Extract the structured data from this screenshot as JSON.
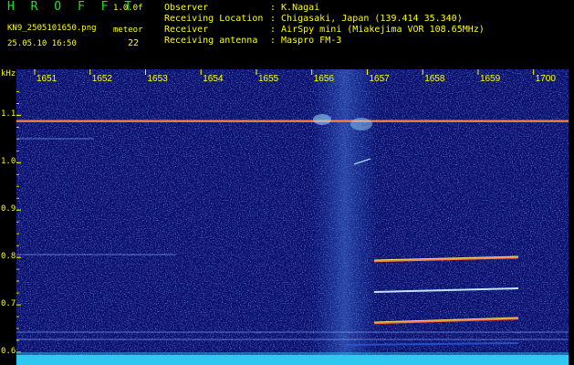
{
  "header": {
    "title": "H R O F F T",
    "version": "1.0.0f",
    "filename": "KN9_2505101650.png",
    "datetime": "25.05.10 16:50",
    "meteor_label": "meteor",
    "meteor_count": "22",
    "info": [
      {
        "label": "Observer",
        "value": ": K.Nagai"
      },
      {
        "label": "Receiving Location",
        "value": ": Chigasaki, Japan (139.414 35.340)"
      },
      {
        "label": "Receiver",
        "value": ": AirSpy mini (Miakejima VOR 108.65MHz)"
      },
      {
        "label": "Receiving antenna",
        "value": ": Maspro FM-3"
      }
    ]
  },
  "chart_data": {
    "type": "heatmap",
    "x_tick_labels": [
      "1651",
      "1652",
      "1653",
      "1654",
      "1655",
      "1656",
      "1657",
      "1658",
      "1659",
      "1700"
    ],
    "y_unit": "kHz",
    "y_tick_labels": [
      "1.1",
      "1.0",
      "0.9",
      "0.8",
      "0.7",
      "0.6"
    ],
    "y_ticks": [
      1.1,
      1.0,
      0.9,
      0.8,
      0.7,
      0.6
    ],
    "ylim": [
      0.573,
      1.197
    ],
    "colors": {
      "background": "#0a0f6e",
      "noise": "#2a5ad8",
      "carrier": "#ff5a3c",
      "echo": "#e8e86a",
      "axis": "#ffff00",
      "bottom": "#30c8f0"
    }
  }
}
